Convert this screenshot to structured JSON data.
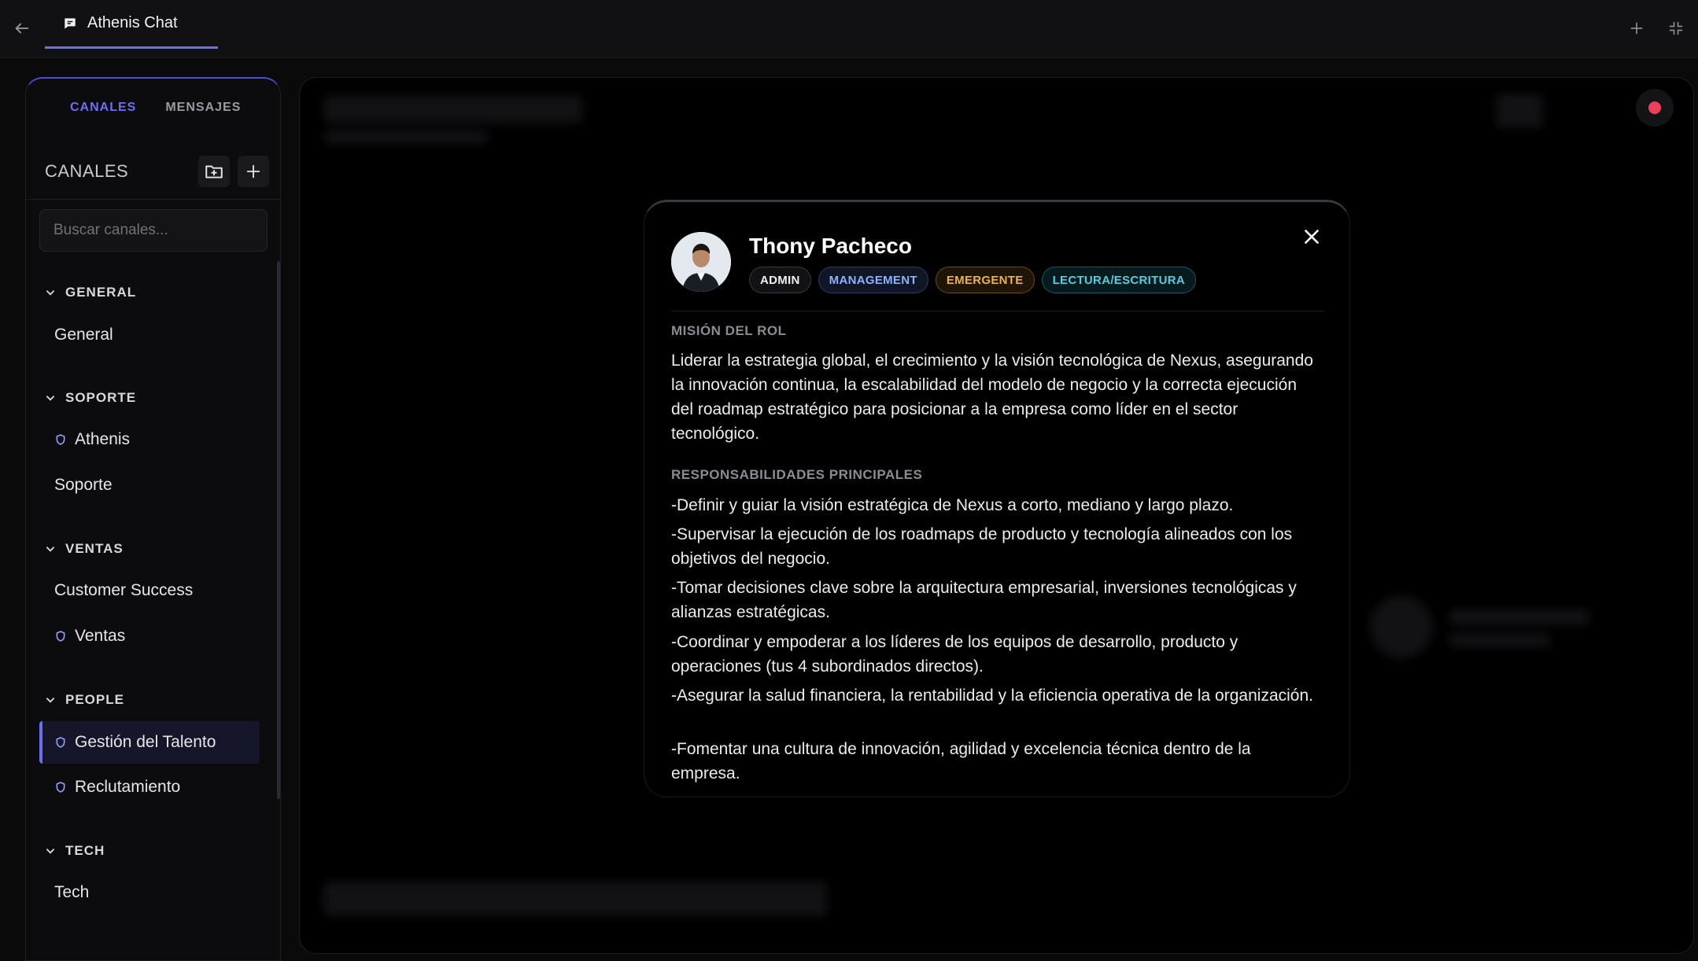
{
  "topbar": {
    "tab_title": "Athenis Chat"
  },
  "sidebar": {
    "tabs": [
      "CANALES",
      "MENSAJES"
    ],
    "header_title": "CANALES",
    "search_placeholder": "Buscar canales...",
    "groups": [
      {
        "title": "GENERAL",
        "channels": [
          {
            "label": "General",
            "private": false
          }
        ]
      },
      {
        "title": "SOPORTE",
        "channels": [
          {
            "label": "Athenis",
            "private": true
          },
          {
            "label": "Soporte",
            "private": false
          }
        ]
      },
      {
        "title": "VENTAS",
        "channels": [
          {
            "label": "Customer Success",
            "private": false
          },
          {
            "label": "Ventas",
            "private": true
          }
        ]
      },
      {
        "title": "PEOPLE",
        "channels": [
          {
            "label": "Gestión del Talento",
            "private": true,
            "active": true
          },
          {
            "label": "Reclutamiento",
            "private": true
          }
        ]
      },
      {
        "title": "TECH",
        "channels": [
          {
            "label": "Tech",
            "private": false
          }
        ]
      }
    ]
  },
  "modal": {
    "name": "Thony Pacheco",
    "badges": [
      "ADMIN",
      "MANAGEMENT",
      "EMERGENTE",
      "LECTURA/ESCRITURA"
    ],
    "mission_title": "MISIÓN DEL ROL",
    "mission_text": "Liderar la estrategia global, el crecimiento y la visión tecnológica de Nexus, asegurando la innovación continua, la escalabilidad del modelo de negocio y la correcta ejecución del roadmap estratégico para posicionar a la empresa como líder en el sector tecnológico.",
    "resp_title": "RESPONSABILIDADES PRINCIPALES",
    "responsibilities": [
      "-Definir y guiar la visión estratégica de Nexus a corto, mediano y largo plazo.",
      "-Supervisar la ejecución de los roadmaps de producto y tecnología alineados con los objetivos del negocio.",
      "-Tomar decisiones clave sobre la arquitectura empresarial, inversiones tecnológicas y alianzas estratégicas.",
      "-Coordinar y empoderar a los líderes de los equipos de desarrollo, producto y operaciones (tus 4 subordinados directos).",
      "-Asegurar la salud financiera, la rentabilidad y la eficiencia operativa de la organización.",
      "-Fomentar una cultura de innovación, agilidad y excelencia técnica dentro de la empresa."
    ]
  },
  "colors": {
    "accent": "#6d6df5",
    "record": "#ee3f5c"
  }
}
